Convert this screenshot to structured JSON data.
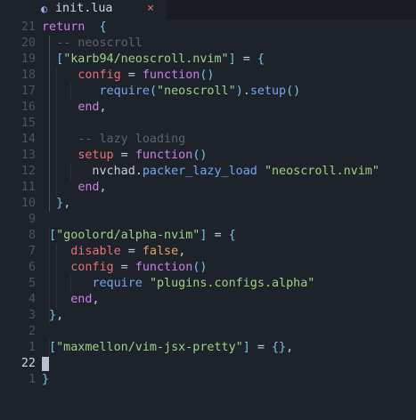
{
  "tab": {
    "filename": "init.lua",
    "close_symbol": "×",
    "file_icon": "lua-file-icon"
  },
  "colors": {
    "background": "#1e222a",
    "keyword": "#c882e7",
    "string": "#9fd18b",
    "comment": "#5c6370",
    "boolean": "#e8a35f",
    "function": "#74a7f0",
    "property": "#e96d78",
    "bracket": "#74c3e8"
  },
  "cursor_line": 22,
  "lines": [
    {
      "n": "21",
      "indent": 0,
      "tokens": [
        [
          "kw",
          "return"
        ],
        [
          "",
          "  "
        ],
        [
          "br",
          "{"
        ]
      ]
    },
    {
      "n": "20",
      "indent": 1,
      "tokens": [
        [
          "cmt",
          "  -- neoscroll"
        ]
      ]
    },
    {
      "n": "19",
      "indent": 1,
      "tokens": [
        [
          "br",
          "  ["
        ],
        [
          "str",
          "\"karb94/neoscroll.nvim\""
        ],
        [
          "br",
          "]"
        ],
        [
          "",
          " = "
        ],
        [
          "br",
          "{"
        ]
      ]
    },
    {
      "n": "18",
      "indent": 2,
      "tokens": [
        [
          "",
          "     "
        ],
        [
          "prop",
          "config"
        ],
        [
          "",
          " = "
        ],
        [
          "kw",
          "function"
        ],
        [
          "br",
          "()"
        ]
      ]
    },
    {
      "n": "17",
      "indent": 3,
      "tokens": [
        [
          "",
          "        "
        ],
        [
          "fn",
          "require"
        ],
        [
          "br",
          "("
        ],
        [
          "str",
          "\"neoscroll\""
        ],
        [
          "br",
          ")"
        ],
        [
          "",
          "."
        ],
        [
          "fn",
          "setup"
        ],
        [
          "br",
          "()"
        ]
      ]
    },
    {
      "n": "16",
      "indent": 2,
      "tokens": [
        [
          "",
          "     "
        ],
        [
          "kw",
          "end"
        ],
        [
          "",
          ","
        ]
      ]
    },
    {
      "n": "15",
      "indent": 2,
      "tokens": []
    },
    {
      "n": "14",
      "indent": 2,
      "tokens": [
        [
          "cmt",
          "     -- lazy loading"
        ]
      ]
    },
    {
      "n": "13",
      "indent": 2,
      "tokens": [
        [
          "",
          "     "
        ],
        [
          "prop",
          "setup"
        ],
        [
          "",
          " = "
        ],
        [
          "kw",
          "function"
        ],
        [
          "br",
          "()"
        ]
      ]
    },
    {
      "n": "12",
      "indent": 3,
      "tokens": [
        [
          "",
          "       nvchad."
        ],
        [
          "fn",
          "packer_lazy_load"
        ],
        [
          "",
          " "
        ],
        [
          "str",
          "\"neoscroll.nvim\""
        ]
      ]
    },
    {
      "n": "11",
      "indent": 2,
      "tokens": [
        [
          "",
          "     "
        ],
        [
          "kw",
          "end"
        ],
        [
          "",
          ","
        ]
      ]
    },
    {
      "n": "10",
      "indent": 1,
      "tokens": [
        [
          "",
          "  "
        ],
        [
          "br",
          "}"
        ],
        [
          "",
          ","
        ]
      ]
    },
    {
      "n": "9",
      "indent": 0,
      "tokens": []
    },
    {
      "n": "8",
      "indent": 1,
      "tokens": [
        [
          "br",
          " ["
        ],
        [
          "str",
          "\"goolord/alpha-nvim\""
        ],
        [
          "br",
          "]"
        ],
        [
          "",
          " = "
        ],
        [
          "br",
          "{"
        ]
      ]
    },
    {
      "n": "7",
      "indent": 2,
      "tokens": [
        [
          "",
          "    "
        ],
        [
          "prop",
          "disable"
        ],
        [
          "",
          " = "
        ],
        [
          "bool",
          "false"
        ],
        [
          "",
          ","
        ]
      ]
    },
    {
      "n": "6",
      "indent": 2,
      "tokens": [
        [
          "",
          "    "
        ],
        [
          "prop",
          "config"
        ],
        [
          "",
          " = "
        ],
        [
          "kw",
          "function"
        ],
        [
          "br",
          "()"
        ]
      ]
    },
    {
      "n": "5",
      "indent": 3,
      "tokens": [
        [
          "",
          "       "
        ],
        [
          "fn",
          "require"
        ],
        [
          "",
          " "
        ],
        [
          "str",
          "\"plugins.configs.alpha\""
        ]
      ]
    },
    {
      "n": "4",
      "indent": 2,
      "tokens": [
        [
          "",
          "    "
        ],
        [
          "kw",
          "end"
        ],
        [
          "",
          ","
        ]
      ]
    },
    {
      "n": "3",
      "indent": 1,
      "tokens": [
        [
          "br",
          " }"
        ],
        [
          "",
          ","
        ]
      ]
    },
    {
      "n": "2",
      "indent": 0,
      "tokens": []
    },
    {
      "n": "1",
      "indent": 1,
      "tokens": [
        [
          "br",
          " ["
        ],
        [
          "str",
          "\"maxmellon/vim-jsx-pretty\""
        ],
        [
          "br",
          "]"
        ],
        [
          "",
          " = "
        ],
        [
          "br",
          "{}"
        ],
        [
          "",
          ","
        ]
      ]
    },
    {
      "n": "22",
      "indent": 0,
      "tokens": [],
      "current": true
    },
    {
      "n": "1",
      "indent": 0,
      "tokens": [
        [
          "br",
          "}"
        ]
      ]
    }
  ]
}
